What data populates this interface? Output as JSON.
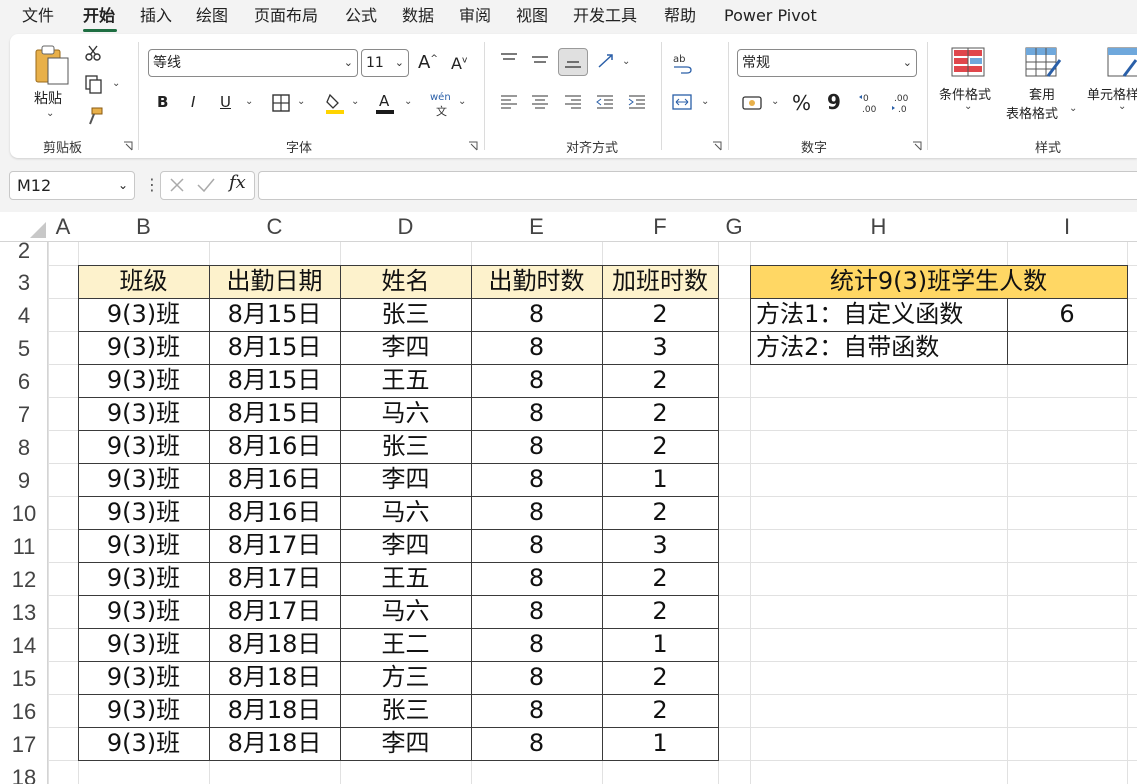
{
  "menu": {
    "tabs": [
      "文件",
      "开始",
      "插入",
      "绘图",
      "页面布局",
      "公式",
      "数据",
      "审阅",
      "视图",
      "开发工具",
      "帮助",
      "Power Pivot"
    ]
  },
  "ribbon": {
    "clipboard": {
      "paste_label": "粘贴",
      "group_label": "剪贴板"
    },
    "font": {
      "font_name": "等线",
      "font_size": "11",
      "group_label": "字体",
      "bold": "B",
      "italic": "I",
      "underline": "U",
      "phonetic": "wén"
    },
    "alignment": {
      "group_label": "对齐方式"
    },
    "number": {
      "format": "常规",
      "group_label": "数字",
      "percent": "%",
      "comma": "9"
    },
    "styles": {
      "conditional_format": "条件格式",
      "table_format_line1": "套用",
      "table_format_line2": "表格格式",
      "cell_styles": "单元格样",
      "group_label": "样式"
    }
  },
  "formula_bar": {
    "name_box": "M12",
    "fx": "fx",
    "formula": ""
  },
  "sheet": {
    "columns": [
      "A",
      "B",
      "C",
      "D",
      "E",
      "F",
      "G",
      "H",
      "I"
    ],
    "rows": [
      "2",
      "3",
      "4",
      "5",
      "6",
      "7",
      "8",
      "9",
      "10",
      "11",
      "12",
      "13",
      "14",
      "15",
      "16",
      "17",
      "18"
    ],
    "table": {
      "headers": [
        "班级",
        "出勤日期",
        "姓名",
        "出勤时数",
        "加班时数"
      ],
      "rows": [
        [
          "9(3)班",
          "8月15日",
          "张三",
          "8",
          "2"
        ],
        [
          "9(3)班",
          "8月15日",
          "李四",
          "8",
          "3"
        ],
        [
          "9(3)班",
          "8月15日",
          "王五",
          "8",
          "2"
        ],
        [
          "9(3)班",
          "8月15日",
          "马六",
          "8",
          "2"
        ],
        [
          "9(3)班",
          "8月16日",
          "张三",
          "8",
          "2"
        ],
        [
          "9(3)班",
          "8月16日",
          "李四",
          "8",
          "1"
        ],
        [
          "9(3)班",
          "8月16日",
          "马六",
          "8",
          "2"
        ],
        [
          "9(3)班",
          "8月17日",
          "李四",
          "8",
          "3"
        ],
        [
          "9(3)班",
          "8月17日",
          "王五",
          "8",
          "2"
        ],
        [
          "9(3)班",
          "8月17日",
          "马六",
          "8",
          "2"
        ],
        [
          "9(3)班",
          "8月18日",
          "王二",
          "8",
          "1"
        ],
        [
          "9(3)班",
          "8月18日",
          "方三",
          "8",
          "2"
        ],
        [
          "9(3)班",
          "8月18日",
          "张三",
          "8",
          "2"
        ],
        [
          "9(3)班",
          "8月18日",
          "李四",
          "8",
          "1"
        ]
      ]
    },
    "stats": {
      "title": "统计9(3)班学生人数",
      "method1_label": "方法1：自定义函数",
      "method1_value": "6",
      "method2_label": "方法2：自带函数",
      "method2_value": ""
    }
  },
  "colors": {
    "accent": "#1e6e42",
    "header_fill": "#fdf2cc",
    "title_fill": "#ffd764"
  }
}
